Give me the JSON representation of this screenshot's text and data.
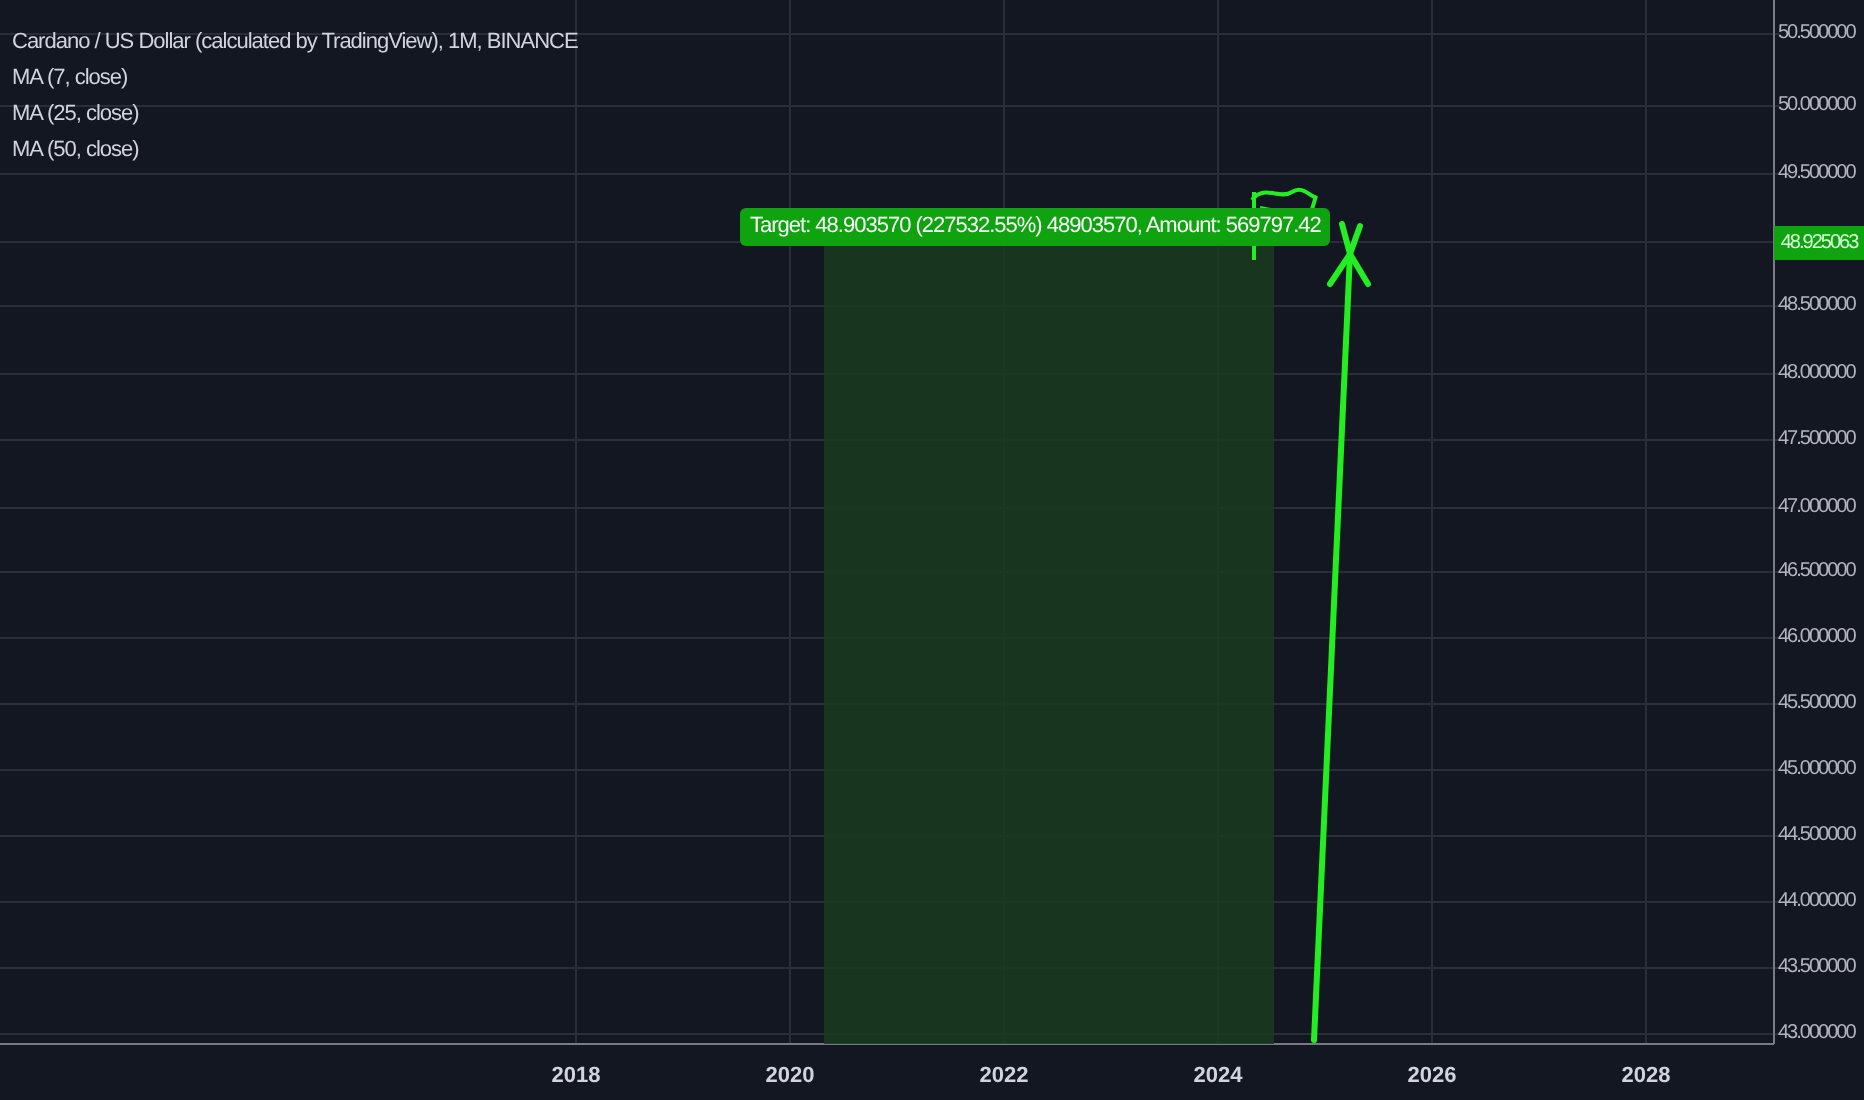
{
  "legend": {
    "title": "Cardano / US Dollar (calculated by TradingView), 1M, BINANCE",
    "indicators": [
      "MA (7, close)",
      "MA (25, close)",
      "MA (50, close)"
    ]
  },
  "target_label": "Target: 48.903570 (227532.55%) 48903570, Amount: 569797.42",
  "price_axis": [
    "50.500000",
    "50.000000",
    "49.500000",
    "48.500000",
    "48.000000",
    "47.500000",
    "47.000000",
    "46.500000",
    "46.000000",
    "45.500000",
    "45.000000",
    "44.500000",
    "44.000000",
    "43.500000",
    "43.000000"
  ],
  "current_price": "48.925063",
  "time_axis": [
    "2018",
    "2020",
    "2022",
    "2024",
    "2026",
    "2028"
  ]
}
